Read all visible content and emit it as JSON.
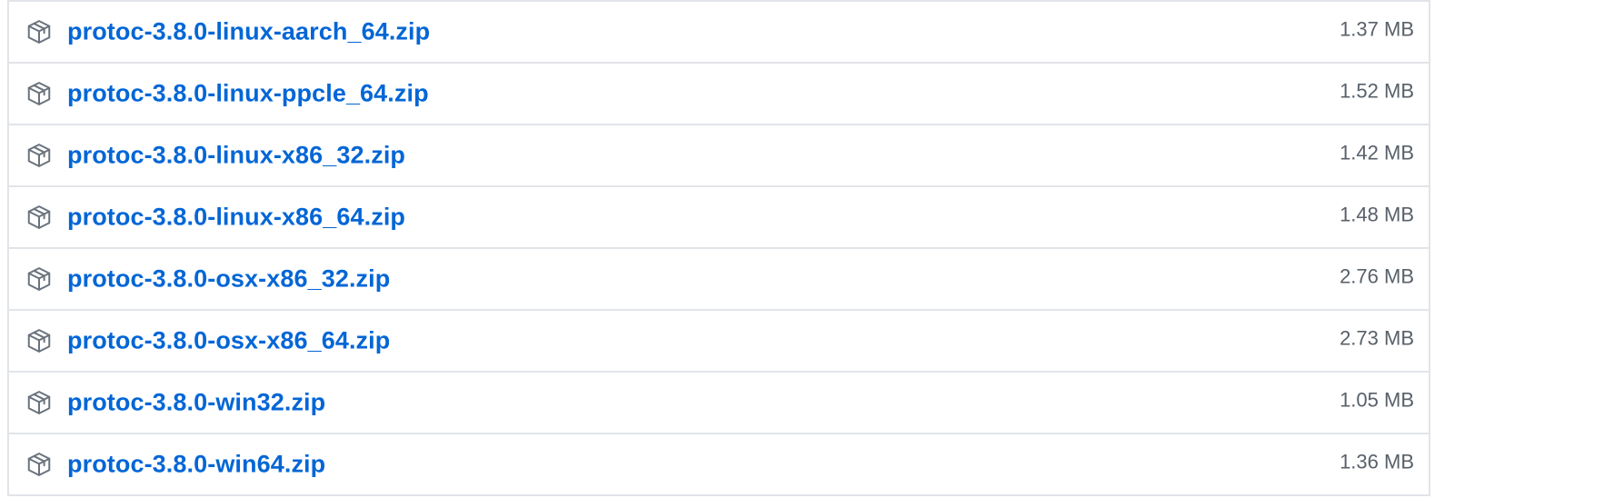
{
  "release_assets": {
    "icon": "package-icon",
    "colors": {
      "link": "#0366d6",
      "size_text": "#586069",
      "border": "#e1e4e8",
      "icon_stroke": "#6a737d"
    },
    "items": [
      {
        "name": "protoc-3.8.0-linux-aarch_64.zip",
        "size": "1.37 MB"
      },
      {
        "name": "protoc-3.8.0-linux-ppcle_64.zip",
        "size": "1.52 MB"
      },
      {
        "name": "protoc-3.8.0-linux-x86_32.zip",
        "size": "1.42 MB"
      },
      {
        "name": "protoc-3.8.0-linux-x86_64.zip",
        "size": "1.48 MB"
      },
      {
        "name": "protoc-3.8.0-osx-x86_32.zip",
        "size": "2.76 MB"
      },
      {
        "name": "protoc-3.8.0-osx-x86_64.zip",
        "size": "2.73 MB"
      },
      {
        "name": "protoc-3.8.0-win32.zip",
        "size": "1.05 MB"
      },
      {
        "name": "protoc-3.8.0-win64.zip",
        "size": "1.36 MB"
      }
    ]
  }
}
